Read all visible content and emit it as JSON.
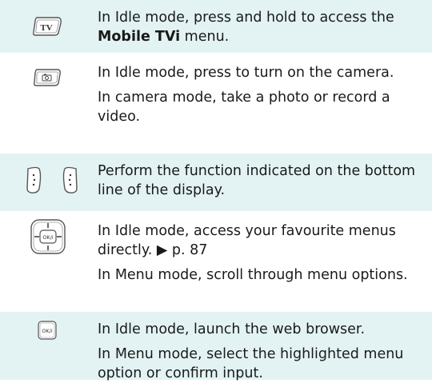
{
  "rows": [
    {
      "icon": "tv-key-icon",
      "paras": [
        {
          "pre": "In Idle mode, press and hold to access the ",
          "bold": "Mobile TVi",
          "post": " menu."
        }
      ]
    },
    {
      "icon": "camera-key-icon",
      "paras": [
        {
          "text": "In Idle mode, press to turn on the camera."
        },
        {
          "text": "In camera mode, take a photo or record a video."
        }
      ]
    },
    {
      "icon": "soft-keys-icon",
      "paras": [
        {
          "text": "Perform the function indicated on the bottom line of the display."
        }
      ]
    },
    {
      "icon": "navigation-key-icon",
      "paras": [
        {
          "text": "In Idle mode, access your favourite menus directly. ▶ p. 87"
        },
        {
          "text": "In Menu mode, scroll through menu options."
        }
      ]
    },
    {
      "icon": "ok-key-icon",
      "paras": [
        {
          "text": "In Idle mode, launch the web browser."
        },
        {
          "text": "In Menu mode, select the highlighted menu option or confirm input."
        }
      ]
    }
  ],
  "labels": {
    "tv_key": "TV",
    "ok_key": "OK/i"
  }
}
